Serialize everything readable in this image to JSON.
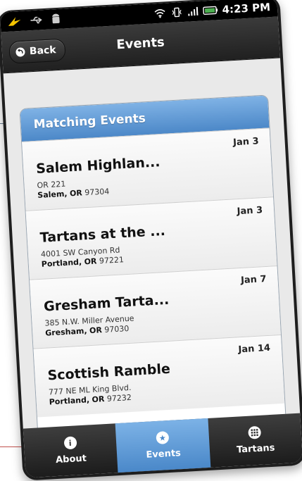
{
  "status_bar": {
    "time": "4:23 PM"
  },
  "header": {
    "back_label": "Back",
    "title": "Events"
  },
  "list": {
    "title": "Matching Events",
    "events": [
      {
        "name": "Salem Highlan...",
        "date": "Jan 3",
        "address": "OR 221",
        "city": "Salem,",
        "state": "OR",
        "zip": "97304"
      },
      {
        "name": "Tartans at the ...",
        "date": "Jan 3",
        "address": "4001 SW Canyon Rd",
        "city": "Portland,",
        "state": "OR",
        "zip": "97221"
      },
      {
        "name": "Gresham Tarta...",
        "date": "Jan 7",
        "address": "385 N.W. Miller Avenue",
        "city": "Gresham,",
        "state": "OR",
        "zip": "97030"
      },
      {
        "name": "Scottish Ramble",
        "date": "Jan 14",
        "address": "777 NE ML King Blvd.",
        "city": "Portland,",
        "state": "OR",
        "zip": "97232"
      }
    ]
  },
  "tabs": [
    {
      "label": "About",
      "icon": "info-icon"
    },
    {
      "label": "Events",
      "icon": "star-icon",
      "active": true
    },
    {
      "label": "Tartans",
      "icon": "grid-icon"
    }
  ],
  "colors": {
    "accent": "#4c88c8",
    "accent_light": "#7fb2e5"
  }
}
